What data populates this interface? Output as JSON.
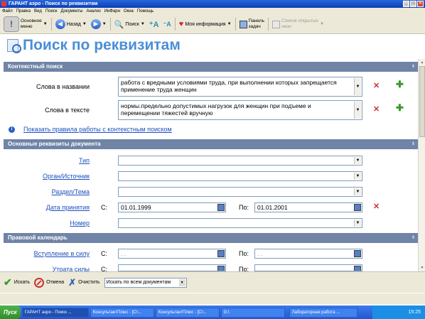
{
  "window": {
    "title": "ГАРАНТ аэро - Поиск по реквизитам"
  },
  "menubar": {
    "items": [
      "Файл",
      "Правка",
      "Вид",
      "Поиск",
      "Документы",
      "Анализ",
      "ИнФарн",
      "Окна",
      "Помощь"
    ]
  },
  "toolbar": {
    "main_menu_line1": "Основное",
    "main_menu_line2": "меню",
    "back_label": "Назад",
    "search_label": "Поиск",
    "my_info_label": "Моя информация",
    "taskpanel_line1": "Панель",
    "taskpanel_line2": "задач",
    "open_windows_line1": "Список открытых",
    "open_windows_line2": "окон"
  },
  "page": {
    "title": "Поиск по реквизитам"
  },
  "context_search": {
    "header": "Контекстный поиск",
    "title_words_label": "Слова в названии",
    "title_words_value": "работа с вредными условиями труда, при выполнении которых запрещается применение труда женщин",
    "text_words_label": "Слова в тексте",
    "text_words_value": "нормы.предельно допустимых нагрузок для женщин при подъеме и перемещении тяжестей вручную",
    "rules_link": "Показать правила работы с контекстным поиском"
  },
  "doc_attributes": {
    "header": "Основные реквизиты документа",
    "type_label": "Тип",
    "source_label": "Орган/Источник",
    "section_label": "Раздел/Тема",
    "date_label": "Дата принятия",
    "from_label": "С:",
    "from_value": "01.01.1999",
    "to_label": "По:",
    "to_value": "01.01.2001",
    "number_label": "Номер"
  },
  "legal_calendar": {
    "header": "Правовой календарь",
    "effective_label": "Вступление в силу",
    "effective_from_label": "С:",
    "effective_from_value": " .  .",
    "effective_to_label": "По:",
    "effective_to_value": " .  .",
    "expiry_label": "Утрата силы",
    "expiry_from_label": "С:",
    "expiry_from_value": " .  .",
    "expiry_to_label": "По:",
    "expiry_to_value": " .  ."
  },
  "bottom": {
    "search_label": "Искать",
    "cancel_label": "Отмена",
    "clear_label": "Очистить",
    "scope_value": "Искать по всем документам"
  },
  "taskbar": {
    "start_label": "Пуск",
    "tasks": [
      "ГАРАНТ аэро - Поиск ...",
      "КонсультантПлюс - [Ст...",
      "КонсультантПлюс - [Ст...",
      "G:\\",
      "Лабораторная работа ..."
    ],
    "clock": "15:25"
  },
  "colors": {
    "section_header": "#6f84a6",
    "title_blue": "#4a8ed6",
    "link_blue": "#1a4fc0",
    "delete_red": "#cc3333",
    "add_green": "#3a9a2a"
  }
}
